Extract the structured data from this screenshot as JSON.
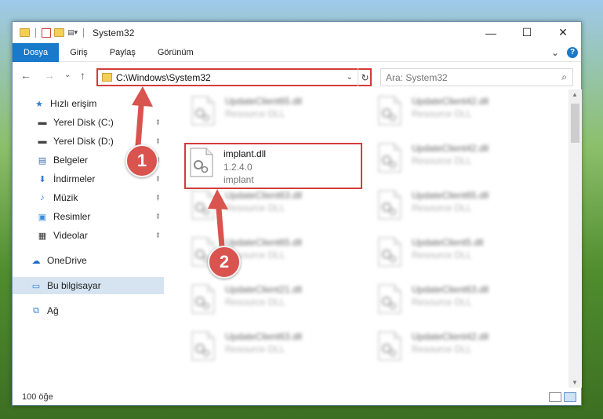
{
  "window": {
    "title": "System32"
  },
  "window_controls": {
    "minimize": "—",
    "maximize": "☐",
    "close": "✕"
  },
  "ribbon": {
    "tabs": [
      "Dosya",
      "Giriş",
      "Paylaş",
      "Görünüm"
    ],
    "active_tab": "Dosya",
    "expand": "⌄",
    "help": "?"
  },
  "navbar": {
    "back": "←",
    "forward": "→",
    "recent": "⌄",
    "up": "↑",
    "address": "C:\\Windows\\System32",
    "address_dropdown": "⌄",
    "refresh": "↻",
    "search_placeholder": "Ara: System32",
    "search_icon": "⌕"
  },
  "sidebar": {
    "items": [
      {
        "label": "Hızlı erişim",
        "icon": "star-icon",
        "glyph": "★",
        "color": "#2f7fd6",
        "pinned": false
      },
      {
        "label": "Yerel Disk (C:)",
        "icon": "drive-icon",
        "glyph": "▬",
        "color": "#444444",
        "pinned": true
      },
      {
        "label": "Yerel Disk (D:)",
        "icon": "drive-icon",
        "glyph": "▬",
        "color": "#444444",
        "pinned": true
      },
      {
        "label": "Belgeler",
        "icon": "documents-icon",
        "glyph": "▤",
        "color": "#3a6ea5",
        "pinned": true
      },
      {
        "label": "İndirmeler",
        "icon": "download-icon",
        "glyph": "⬇",
        "color": "#2f7fd6",
        "pinned": true
      },
      {
        "label": "Müzik",
        "icon": "music-icon",
        "glyph": "♪",
        "color": "#2f7fd6",
        "pinned": true
      },
      {
        "label": "Resimler",
        "icon": "pictures-icon",
        "glyph": "▣",
        "color": "#3a8ad6",
        "pinned": true
      },
      {
        "label": "Videolar",
        "icon": "videos-icon",
        "glyph": "▦",
        "color": "#333333",
        "pinned": true
      },
      {
        "label": "OneDrive",
        "icon": "cloud-icon",
        "glyph": "☁",
        "color": "#1b6ac9",
        "pinned": false
      },
      {
        "label": "Bu bilgisayar",
        "icon": "computer-icon",
        "glyph": "▭",
        "color": "#2f7fd6",
        "pinned": false,
        "selected": true
      },
      {
        "label": "Ağ",
        "icon": "network-icon",
        "glyph": "⧉",
        "color": "#2f7fd6",
        "pinned": false
      }
    ],
    "pin_glyph": "📌"
  },
  "files": {
    "selected": {
      "name": "implant.dll",
      "version": "1.2.4.0",
      "description": "implant"
    },
    "blurred": [
      {
        "name": "UpdateClient65.dll",
        "desc": "Resource DLL"
      },
      {
        "name": "UpdateClient42.dll",
        "desc": "Resource DLL"
      },
      {
        "name": "UpdateClient42.dll",
        "desc": "Resource DLL"
      },
      {
        "name": "UpdateClient63.dll",
        "desc": "Resource DLL"
      },
      {
        "name": "UpdateClient65.dll",
        "desc": "Resource DLL"
      },
      {
        "name": "UpdateClient65.dll",
        "desc": "Resource DLL"
      },
      {
        "name": "UpdateClient5.dll",
        "desc": "Resource DLL"
      },
      {
        "name": "UpdateClient21.dll",
        "desc": "Resource DLL"
      },
      {
        "name": "UpdateClient63.dll",
        "desc": "Resource DLL"
      },
      {
        "name": "UpdateClient63.dll",
        "desc": "Resource DLL"
      },
      {
        "name": "UpdateClient42.dll",
        "desc": "Resource DLL"
      }
    ]
  },
  "status": {
    "count": "100 öğe"
  },
  "annotations": {
    "badge1": "1",
    "badge2": "2",
    "color": "#d9534f"
  }
}
